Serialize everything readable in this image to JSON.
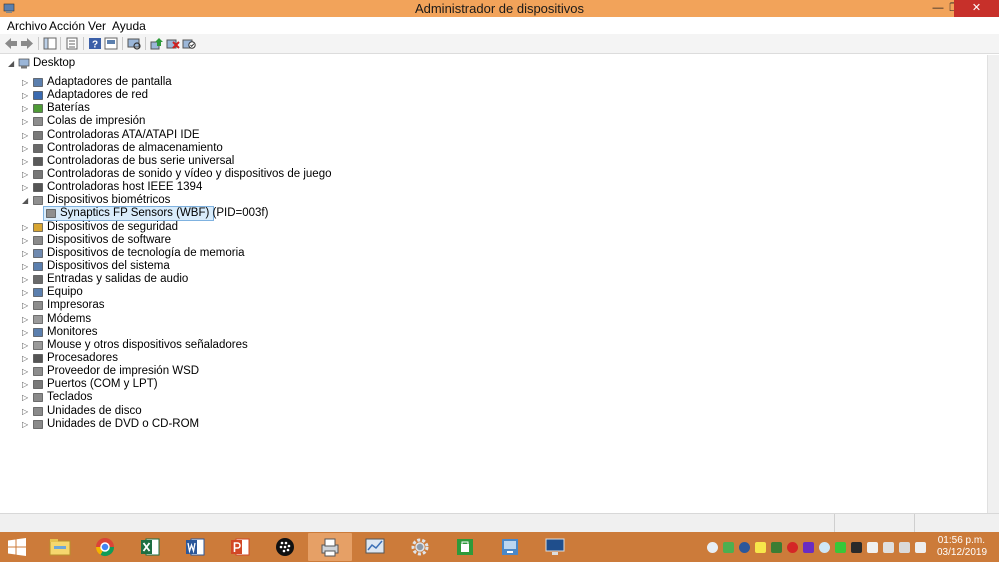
{
  "window": {
    "title": "Administrador de dispositivos",
    "minimize": "—",
    "restore": "❐",
    "close": "✕"
  },
  "menu": [
    "Archivo",
    "Acción",
    "Ver",
    "Ayuda"
  ],
  "tree": {
    "root": "Desktop",
    "items": [
      {
        "label": "Adaptadores de pantalla",
        "icon": "display-adapter-icon",
        "expanded": false
      },
      {
        "label": "Adaptadores de red",
        "icon": "network-adapter-icon",
        "expanded": false
      },
      {
        "label": "Baterías",
        "icon": "battery-icon",
        "expanded": false
      },
      {
        "label": "Colas de impresión",
        "icon": "print-queue-icon",
        "expanded": false
      },
      {
        "label": "Controladoras ATA/ATAPI IDE",
        "icon": "ide-controller-icon",
        "expanded": false
      },
      {
        "label": "Controladoras de almacenamiento",
        "icon": "storage-controller-icon",
        "expanded": false
      },
      {
        "label": "Controladoras de bus serie universal",
        "icon": "usb-icon",
        "expanded": false
      },
      {
        "label": "Controladoras de sonido y vídeo y dispositivos de juego",
        "icon": "sound-icon",
        "expanded": false
      },
      {
        "label": "Controladoras host IEEE 1394",
        "icon": "ieee1394-icon",
        "expanded": false
      },
      {
        "label": "Dispositivos biométricos",
        "icon": "biometric-icon",
        "expanded": true
      },
      {
        "label": "Synaptics FP Sensors (WBF) (PID=003f)",
        "icon": "fingerprint-sensor-icon",
        "child": true,
        "selected": true
      },
      {
        "label": "Dispositivos de seguridad",
        "icon": "security-device-icon",
        "expanded": false
      },
      {
        "label": "Dispositivos de software",
        "icon": "software-device-icon",
        "expanded": false
      },
      {
        "label": "Dispositivos de tecnología de memoria",
        "icon": "memory-tech-icon",
        "expanded": false
      },
      {
        "label": "Dispositivos del sistema",
        "icon": "system-device-icon",
        "expanded": false
      },
      {
        "label": "Entradas y salidas de audio",
        "icon": "audio-io-icon",
        "expanded": false
      },
      {
        "label": "Equipo",
        "icon": "computer-icon",
        "expanded": false
      },
      {
        "label": "Impresoras",
        "icon": "printer-icon",
        "expanded": false
      },
      {
        "label": "Módems",
        "icon": "modem-icon",
        "expanded": false
      },
      {
        "label": "Monitores",
        "icon": "monitor-icon",
        "expanded": false
      },
      {
        "label": "Mouse y otros dispositivos señaladores",
        "icon": "mouse-icon",
        "expanded": false
      },
      {
        "label": "Procesadores",
        "icon": "processor-icon",
        "expanded": false
      },
      {
        "label": "Proveedor de impresión WSD",
        "icon": "wsd-print-icon",
        "expanded": false
      },
      {
        "label": "Puertos (COM y LPT)",
        "icon": "ports-icon",
        "expanded": false
      },
      {
        "label": "Teclados",
        "icon": "keyboard-icon",
        "expanded": false
      },
      {
        "label": "Unidades de disco",
        "icon": "disk-drive-icon",
        "expanded": false
      },
      {
        "label": "Unidades de DVD o CD-ROM",
        "icon": "dvd-icon",
        "expanded": false
      }
    ]
  },
  "clock": {
    "time": "01:56 p.m.",
    "date": "03/12/2019"
  },
  "colors": {
    "titlebar": "#f2a35a",
    "taskbar": "#cc7b3a",
    "close": "#c7302a",
    "selection": "#d9ecfb"
  }
}
